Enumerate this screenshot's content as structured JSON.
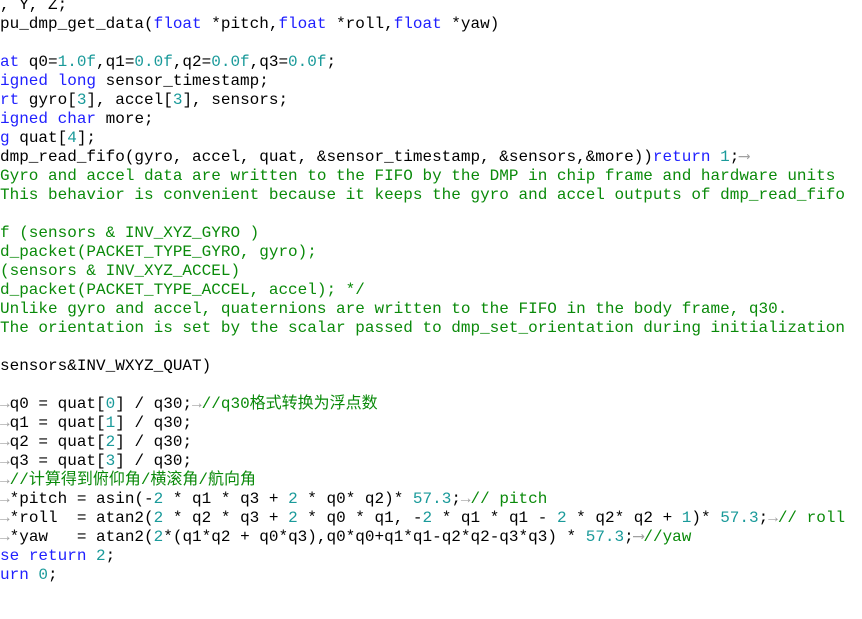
{
  "editor": {
    "colors": {
      "keyword": "#2020ff",
      "number": "#1a9a9a",
      "comment": "#0a8a0a",
      "text": "#000000",
      "whitespace": "#b0b0b0"
    },
    "lines": [
      [
        [
          "t",
          ", Y, Z;"
        ]
      ],
      [
        [
          "t",
          "pu_dmp_get_data("
        ],
        [
          "k",
          "float"
        ],
        [
          "t",
          " *pitch,"
        ],
        [
          "k",
          "float"
        ],
        [
          "t",
          " *roll,"
        ],
        [
          "k",
          "float"
        ],
        [
          "t",
          " *yaw)"
        ]
      ],
      [],
      [
        [
          "k",
          "at"
        ],
        [
          "t",
          " q0="
        ],
        [
          "n",
          "1.0f"
        ],
        [
          "t",
          ",q1="
        ],
        [
          "n",
          "0.0f"
        ],
        [
          "t",
          ",q2="
        ],
        [
          "n",
          "0.0f"
        ],
        [
          "t",
          ",q3="
        ],
        [
          "n",
          "0.0f"
        ],
        [
          "t",
          ";"
        ]
      ],
      [
        [
          "k",
          "igned"
        ],
        [
          "t",
          " "
        ],
        [
          "k",
          "long"
        ],
        [
          "t",
          " sensor_timestamp;"
        ]
      ],
      [
        [
          "k",
          "rt"
        ],
        [
          "t",
          " gyro["
        ],
        [
          "n",
          "3"
        ],
        [
          "t",
          "], accel["
        ],
        [
          "n",
          "3"
        ],
        [
          "t",
          "], sensors;"
        ]
      ],
      [
        [
          "k",
          "igned"
        ],
        [
          "t",
          " "
        ],
        [
          "k",
          "char"
        ],
        [
          "t",
          " more;"
        ]
      ],
      [
        [
          "k",
          "g"
        ],
        [
          "t",
          " quat["
        ],
        [
          "n",
          "4"
        ],
        [
          "t",
          "]; "
        ]
      ],
      [
        [
          "t",
          "dmp_read_fifo(gyro, accel, quat, &sensor_timestamp, &sensors,&more))"
        ],
        [
          "k",
          "return"
        ],
        [
          "t",
          " "
        ],
        [
          "n",
          "1"
        ],
        [
          "t",
          ";"
        ],
        [
          "a",
          "⟶ "
        ]
      ],
      [
        [
          "c",
          "Gyro and accel data are written to the FIFO by the DMP in chip frame and hardware units"
        ]
      ],
      [
        [
          "c",
          "This behavior is convenient because it keeps the gyro and accel outputs of dmp_read_fifo"
        ]
      ],
      [],
      [
        [
          "c",
          "f (sensors & INV_XYZ_GYRO )"
        ]
      ],
      [
        [
          "c",
          "d_packet(PACKET_TYPE_GYRO, gyro);"
        ]
      ],
      [
        [
          "c",
          "(sensors & INV_XYZ_ACCEL)"
        ]
      ],
      [
        [
          "c",
          "d_packet(PACKET_TYPE_ACCEL, accel); */"
        ]
      ],
      [
        [
          "c",
          "Unlike gyro and accel, quaternions are written to the FIFO in the body frame, q30."
        ]
      ],
      [
        [
          "c",
          "The orientation is set by the scalar passed to dmp_set_orientation during initialization"
        ]
      ],
      [],
      [
        [
          "t",
          "sensors&INV_WXYZ_QUAT) "
        ]
      ],
      [],
      [
        [
          "a",
          "→"
        ],
        [
          "t",
          "q0 = quat["
        ],
        [
          "n",
          "0"
        ],
        [
          "t",
          "] / q30;"
        ],
        [
          "a",
          "→"
        ],
        [
          "c",
          "//q30格式转换为浮点数"
        ]
      ],
      [
        [
          "a",
          "→"
        ],
        [
          "t",
          "q1 = quat["
        ],
        [
          "n",
          "1"
        ],
        [
          "t",
          "] / q30;"
        ]
      ],
      [
        [
          "a",
          "→"
        ],
        [
          "t",
          "q2 = quat["
        ],
        [
          "n",
          "2"
        ],
        [
          "t",
          "] / q30;"
        ]
      ],
      [
        [
          "a",
          "→"
        ],
        [
          "t",
          "q3 = quat["
        ],
        [
          "n",
          "3"
        ],
        [
          "t",
          "] / q30; "
        ]
      ],
      [
        [
          "a",
          "→"
        ],
        [
          "c",
          "//计算得到俯仰角/横滚角/航向角"
        ]
      ],
      [
        [
          "a",
          "→"
        ],
        [
          "t",
          "*pitch = asin(-"
        ],
        [
          "n",
          "2"
        ],
        [
          "t",
          " * q1 * q3 + "
        ],
        [
          "n",
          "2"
        ],
        [
          "t",
          " * q0* q2)* "
        ],
        [
          "n",
          "57.3"
        ],
        [
          "t",
          ";"
        ],
        [
          "a",
          "→"
        ],
        [
          "c",
          "// pitch"
        ]
      ],
      [
        [
          "a",
          "→"
        ],
        [
          "t",
          "*roll  = atan2("
        ],
        [
          "n",
          "2"
        ],
        [
          "t",
          " * q2 * q3 + "
        ],
        [
          "n",
          "2"
        ],
        [
          "t",
          " * q0 * q1, -"
        ],
        [
          "n",
          "2"
        ],
        [
          "t",
          " * q1 * q1 - "
        ],
        [
          "n",
          "2"
        ],
        [
          "t",
          " * q2* q2 + "
        ],
        [
          "n",
          "1"
        ],
        [
          "t",
          ")* "
        ],
        [
          "n",
          "57.3"
        ],
        [
          "t",
          ";"
        ],
        [
          "a",
          "→"
        ],
        [
          "c",
          "// roll"
        ]
      ],
      [
        [
          "a",
          "→"
        ],
        [
          "t",
          "*yaw   = atan2("
        ],
        [
          "n",
          "2"
        ],
        [
          "t",
          "*(q1*q2 + q0*q3),q0*q0+q1*q1-q2*q2-q3*q3) * "
        ],
        [
          "n",
          "57.3"
        ],
        [
          "t",
          ";"
        ],
        [
          "a",
          "⟶"
        ],
        [
          "c",
          "//yaw"
        ]
      ],
      [
        [
          "k",
          "se"
        ],
        [
          "t",
          " "
        ],
        [
          "k",
          "return"
        ],
        [
          "t",
          " "
        ],
        [
          "n",
          "2"
        ],
        [
          "t",
          ";"
        ]
      ],
      [
        [
          "k",
          "urn"
        ],
        [
          "t",
          " "
        ],
        [
          "n",
          "0"
        ],
        [
          "t",
          ";"
        ]
      ]
    ]
  }
}
